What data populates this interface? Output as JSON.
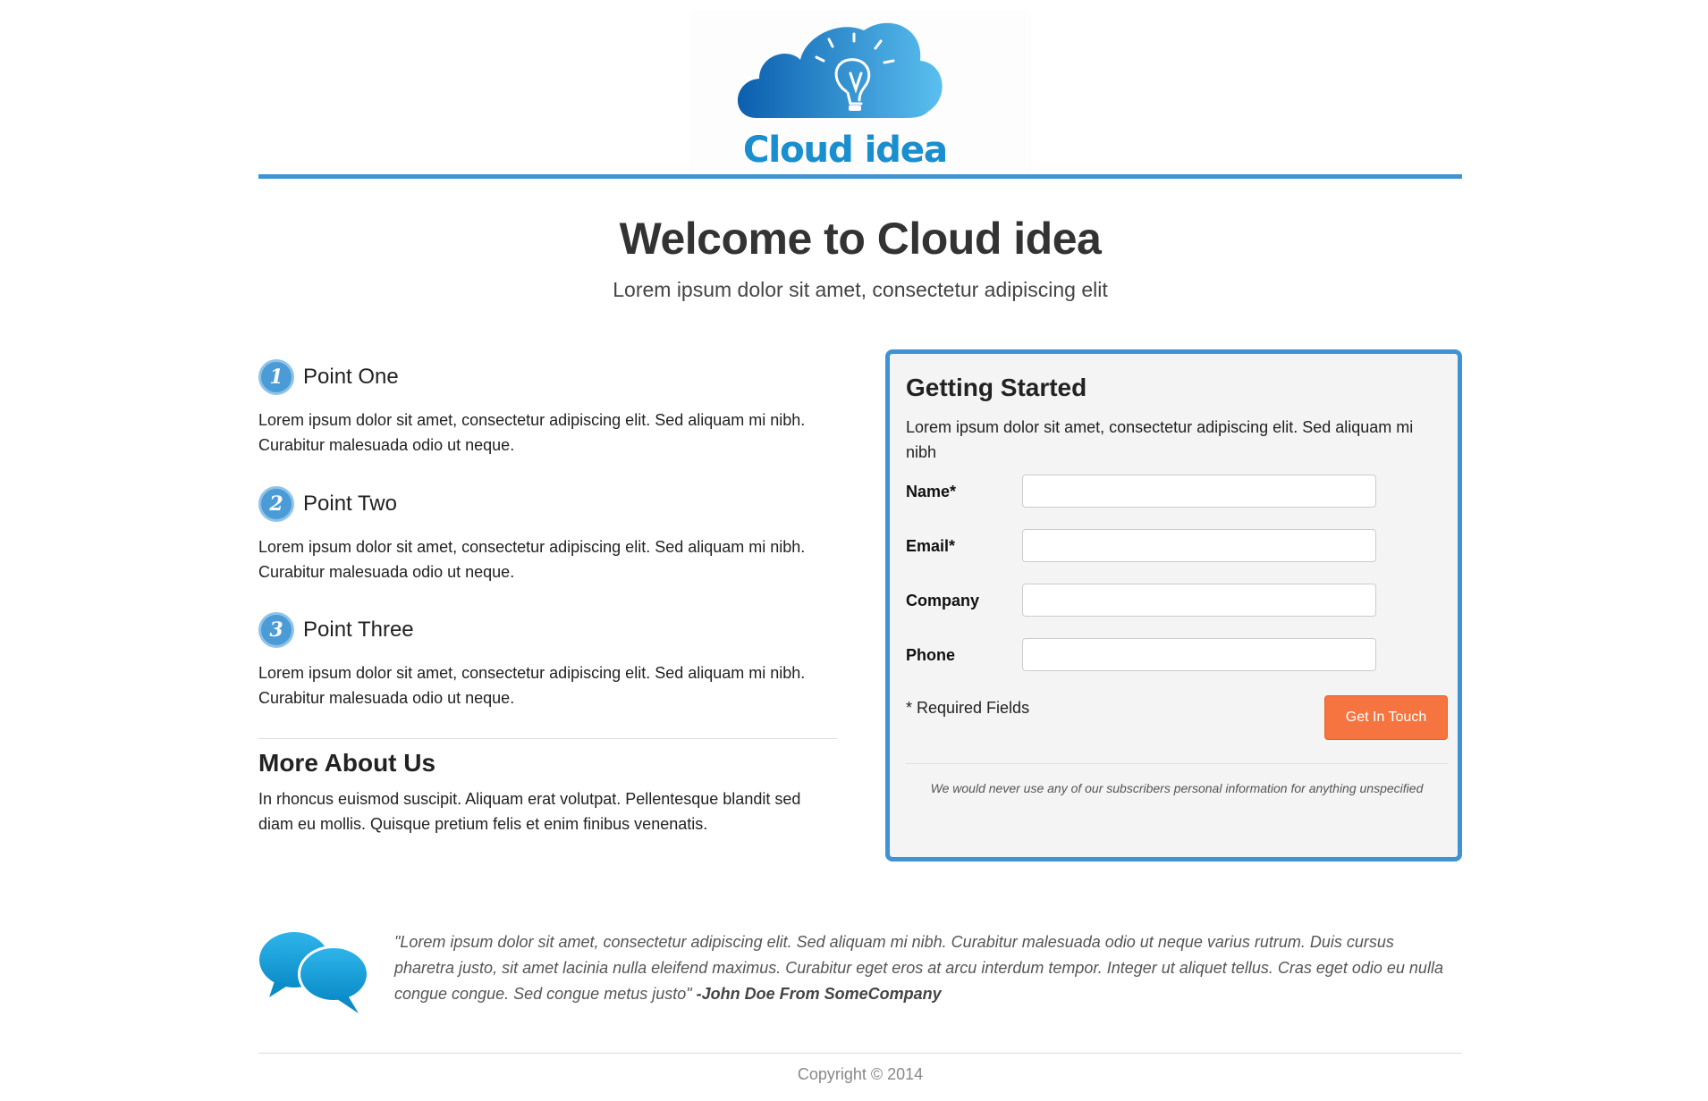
{
  "brand": {
    "logo_text": "Cloud idea",
    "accent_color": "#3f93d2",
    "button_color": "#f6743f"
  },
  "hero": {
    "title": "Welcome to Cloud idea",
    "subtitle": "Lorem ipsum dolor sit amet, consectetur adipiscing elit"
  },
  "points": [
    {
      "number": "1",
      "title": "Point One",
      "body": "Lorem ipsum dolor sit amet, consectetur adipiscing elit. Sed aliquam mi nibh. Curabitur malesuada odio ut neque."
    },
    {
      "number": "2",
      "title": "Point Two",
      "body": "Lorem ipsum dolor sit amet, consectetur adipiscing elit. Sed aliquam mi nibh. Curabitur malesuada odio ut neque."
    },
    {
      "number": "3",
      "title": "Point Three",
      "body": "Lorem ipsum dolor sit amet, consectetur adipiscing elit. Sed aliquam mi nibh. Curabitur malesuada odio ut neque."
    }
  ],
  "about": {
    "title": "More About Us",
    "body": "In rhoncus euismod suscipit. Aliquam erat volutpat. Pellentesque blandit sed diam eu mollis. Quisque pretium felis et enim finibus venenatis."
  },
  "form": {
    "title": "Getting Started",
    "description": "Lorem ipsum dolor sit amet, consectetur adipiscing elit. Sed aliquam mi nibh",
    "fields": [
      {
        "label": "Name*",
        "value": "",
        "placeholder": ""
      },
      {
        "label": "Email*",
        "value": "",
        "placeholder": ""
      },
      {
        "label": "Company",
        "value": "",
        "placeholder": ""
      },
      {
        "label": "Phone",
        "value": "",
        "placeholder": ""
      }
    ],
    "required_note": "* Required Fields",
    "submit_label": "Get In Touch",
    "privacy_note": "We would never use any of our subscribers personal information for anything unspecified"
  },
  "testimonial": {
    "icon": "speech-bubbles-icon",
    "quote": "\"Lorem ipsum dolor sit amet, consectetur adipiscing elit. Sed aliquam mi nibh. Curabitur malesuada odio ut neque varius rutrum. Duis cursus pharetra justo, sit amet lacinia nulla eleifend maximus. Curabitur eget eros at arcu interdum tempor. Integer ut aliquet tellus. Cras eget odio eu nulla congue congue. Sed congue metus justo\"",
    "author": "-John Doe From SomeCompany"
  },
  "footer": {
    "copyright": "Copyright © 2014"
  }
}
